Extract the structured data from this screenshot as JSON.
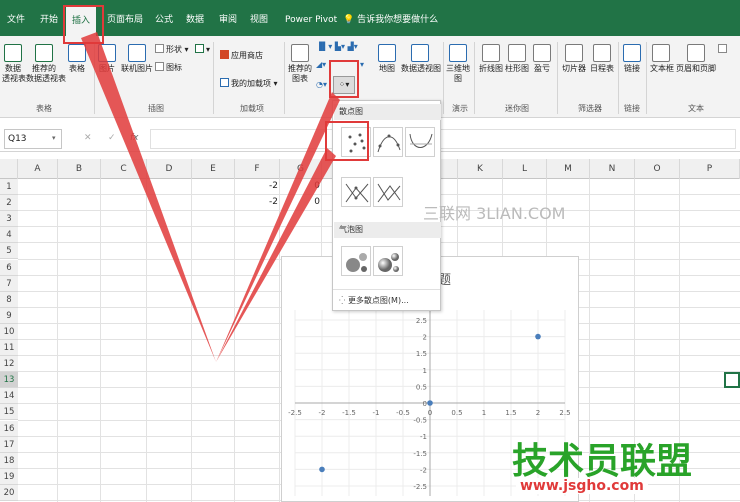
{
  "tabs": [
    "文件",
    "开始",
    "插入",
    "页面布局",
    "公式",
    "数据",
    "审阅",
    "视图",
    "Power Pivot",
    "告诉我你想要做什么"
  ],
  "ribbon": {
    "pivot_table": "数据\n透视表",
    "recommended_pivot": "推荐的\n数据透视表",
    "table": "表格",
    "pictures": "图片",
    "online_pictures": "联机图片",
    "shapes": "形状",
    "icons": "图标",
    "store": "应用商店",
    "my_addins": "我的加载项",
    "recommended_charts": "推荐的\n图表",
    "maps": "地图",
    "pivot_chart": "数据透视图",
    "3d_map": "三维地\n图",
    "line": "折线图",
    "column": "柱形图",
    "win_loss": "盈亏",
    "slicer": "切片器",
    "timeline": "日程表",
    "link": "链接",
    "textbox": "文本框",
    "header_footer": "页眉和页脚"
  },
  "groups": [
    "表格",
    "插图",
    "加载项",
    "演示",
    "迷你图",
    "筛选器",
    "链接",
    "文本"
  ],
  "formula": {
    "namebox": "Q13",
    "cancel": "✕",
    "enter": "✓",
    "fx": "fx"
  },
  "columns": [
    "A",
    "B",
    "C",
    "D",
    "E",
    "F",
    "G",
    "H",
    "I",
    "J",
    "K",
    "L",
    "M",
    "N",
    "O",
    "P"
  ],
  "rows": [
    "1",
    "2",
    "3",
    "4",
    "5",
    "6",
    "7",
    "8",
    "9",
    "10",
    "11",
    "12",
    "13",
    "14",
    "15",
    "16",
    "17",
    "18",
    "19",
    "20"
  ],
  "cells": {
    "f1": "-2",
    "f2": "-2",
    "g1": "0",
    "g2": "0"
  },
  "dropdown": {
    "scatter_header": "散点图",
    "bubble_header": "气泡图",
    "more": "更多散点图(M)..."
  },
  "chart_data": {
    "type": "scatter",
    "title": "题",
    "x": [
      -2,
      0,
      2
    ],
    "y": [
      -2,
      0,
      2
    ],
    "xlim": [
      -2.5,
      2.5
    ],
    "ylim": [
      -2.5,
      2.5
    ],
    "xticks": [
      "-2.5",
      "-2",
      "-1.5",
      "-1",
      "-0.5",
      "0",
      "0.5",
      "1",
      "1.5",
      "2",
      "2.5"
    ],
    "yticks": [
      "2.5",
      "2",
      "1.5",
      "1",
      "0.5",
      "0",
      "-0.5",
      "-1",
      "-1.5",
      "-2",
      "-2.5"
    ],
    "point_color": "#4a7ebb"
  },
  "watermarks": {
    "center": "三联网 3LIAN.COM",
    "brand": "技术员联盟",
    "url": "www.jsgho.com"
  },
  "colors": {
    "excel_green": "#217346",
    "annotation_red": "#e03a3a"
  }
}
